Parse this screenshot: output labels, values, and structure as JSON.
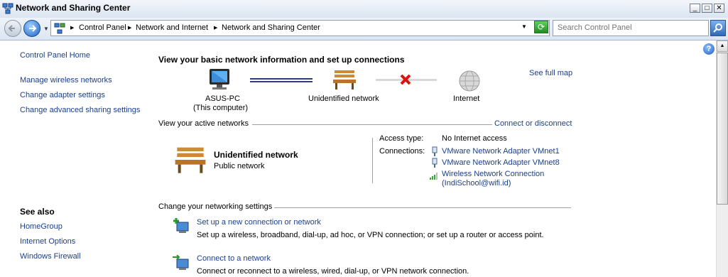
{
  "window": {
    "title": "Network and Sharing Center"
  },
  "address": {
    "crumbs": [
      "Control Panel",
      "Network and Internet",
      "Network and Sharing Center"
    ],
    "search_placeholder": "Search Control Panel"
  },
  "sidebar": {
    "home": "Control Panel Home",
    "tasks": [
      "Manage wireless networks",
      "Change adapter settings",
      "Change advanced sharing settings"
    ],
    "see_also_title": "See also",
    "see_also": [
      "HomeGroup",
      "Internet Options",
      "Windows Firewall"
    ]
  },
  "main": {
    "heading": "View your basic network information and set up connections",
    "see_full_map": "See full map",
    "map": {
      "computer_name": "ASUS-PC",
      "computer_sub": "(This computer)",
      "network": "Unidentified network",
      "internet": "Internet"
    },
    "active_section": "View your active networks",
    "connect_disconnect": "Connect or disconnect",
    "active_network": {
      "name": "Unidentified network",
      "type": "Public network",
      "access_label": "Access type:",
      "access_value": "No Internet access",
      "connections_label": "Connections:",
      "connections": [
        "VMware Network Adapter VMnet1",
        "VMware Network Adapter VMnet8",
        "Wireless Network Connection",
        "(IndiSchool@wifi.id)"
      ]
    },
    "change_section": "Change your networking settings",
    "settings": [
      {
        "title": "Set up a new connection or network",
        "desc": "Set up a wireless, broadband, dial-up, ad hoc, or VPN connection; or set up a router or access point."
      },
      {
        "title": "Connect to a network",
        "desc": "Connect or reconnect to a wireless, wired, dial-up, or VPN network connection."
      }
    ]
  }
}
